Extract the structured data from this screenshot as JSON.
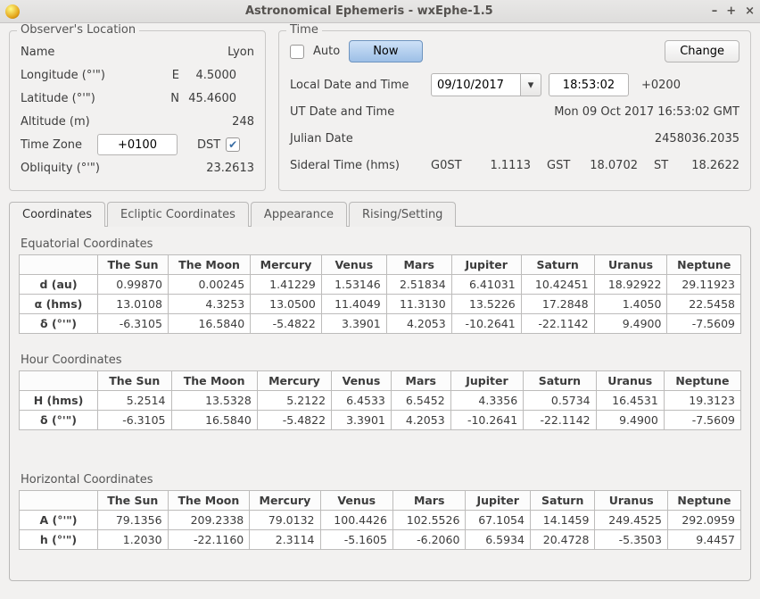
{
  "window": {
    "title": "Astronomical Ephemeris - wxEphe-1.5"
  },
  "observer": {
    "legend": "Observer's Location",
    "name_label": "Name",
    "name_value": "Lyon",
    "longitude_label": "Longitude (°'\")",
    "longitude_prefix": "E",
    "longitude_value": "4.5000",
    "latitude_label": "Latitude (°'\")",
    "latitude_prefix": "N",
    "latitude_value": "45.4600",
    "altitude_label": "Altitude (m)",
    "altitude_value": "248",
    "tz_label": "Time Zone",
    "tz_value": "+0100",
    "dst_label": "DST",
    "dst_checked": true,
    "obliquity_label": "Obliquity (°'\")",
    "obliquity_value": "23.2613"
  },
  "time": {
    "legend": "Time",
    "auto_label": "Auto",
    "now_label": "Now",
    "change_label": "Change",
    "localdt_label": "Local Date and Time",
    "local_date": "09/10/2017",
    "local_time": "18:53:02",
    "tz_offset": "+0200",
    "utdt_label": "UT Date and Time",
    "utdt_value": "Mon 09 Oct 2017 16:53:02 GMT",
    "julian_label": "Julian Date",
    "julian_value": "2458036.2035",
    "sidereal_label": "Sideral Time (hms)",
    "g0st_label": "G0ST",
    "g0st_value": "1.1113",
    "gst_label": "GST",
    "gst_value": "18.0702",
    "st_label": "ST",
    "st_value": "18.2622"
  },
  "tabs": {
    "coordinates": "Coordinates",
    "ecliptic": "Ecliptic Coordinates",
    "appearance": "Appearance",
    "rising": "Rising/Setting"
  },
  "tables": {
    "bodies": [
      "The Sun",
      "The Moon",
      "Mercury",
      "Venus",
      "Mars",
      "Jupiter",
      "Saturn",
      "Uranus",
      "Neptune"
    ],
    "equatorial": {
      "title": "Equatorial Coordinates",
      "rows": {
        "d_label": "d (au)",
        "d": [
          "0.99870",
          "0.00245",
          "1.41229",
          "1.53146",
          "2.51834",
          "6.41031",
          "10.42451",
          "18.92922",
          "29.11923"
        ],
        "alpha_label": "α (hms)",
        "alpha": [
          "13.0108",
          "4.3253",
          "13.0500",
          "11.4049",
          "11.3130",
          "13.5226",
          "17.2848",
          "1.4050",
          "22.5458"
        ],
        "delta_label": "δ (°'\")",
        "delta": [
          "-6.3105",
          "16.5840",
          "-5.4822",
          "3.3901",
          "4.2053",
          "-10.2641",
          "-22.1142",
          "9.4900",
          "-7.5609"
        ]
      }
    },
    "hour": {
      "title": "Hour Coordinates",
      "rows": {
        "H_label": "H (hms)",
        "H": [
          "5.2514",
          "13.5328",
          "5.2122",
          "6.4533",
          "6.5452",
          "4.3356",
          "0.5734",
          "16.4531",
          "19.3123"
        ],
        "delta_label": "δ (°'\")",
        "delta": [
          "-6.3105",
          "16.5840",
          "-5.4822",
          "3.3901",
          "4.2053",
          "-10.2641",
          "-22.1142",
          "9.4900",
          "-7.5609"
        ]
      }
    },
    "horizontal": {
      "title": "Horizontal Coordinates",
      "rows": {
        "A_label": "A (°'\")",
        "A": [
          "79.1356",
          "209.2338",
          "79.0132",
          "100.4426",
          "102.5526",
          "67.1054",
          "14.1459",
          "249.4525",
          "292.0959"
        ],
        "h_label": "h (°'\")",
        "h": [
          "1.2030",
          "-22.1160",
          "2.3114",
          "-5.1605",
          "-6.2060",
          "6.5934",
          "20.4728",
          "-5.3503",
          "9.4457"
        ]
      }
    }
  }
}
